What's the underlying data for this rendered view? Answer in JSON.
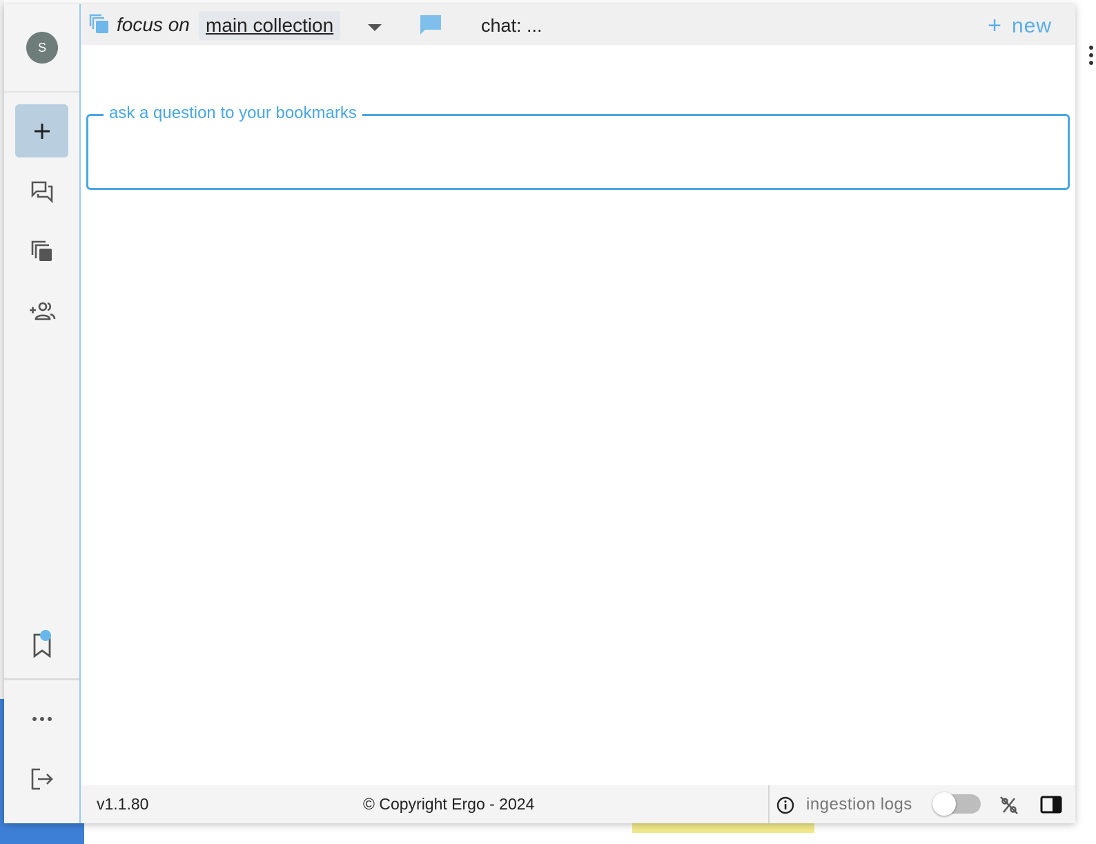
{
  "sidebar": {
    "avatar_initial": "S",
    "items": [
      {
        "name": "new-chat",
        "icon": "plus-icon"
      },
      {
        "name": "chats",
        "icon": "chat-list-icon"
      },
      {
        "name": "collections",
        "icon": "collections-icon"
      },
      {
        "name": "invite",
        "icon": "add-group-icon"
      }
    ],
    "bookmark_icon": "bookmark-icon",
    "more_icon": "more-horiz-icon",
    "logout_icon": "logout-icon"
  },
  "header": {
    "focus_label": "focus on",
    "collection": "main collection",
    "chat_title": "chat: ...",
    "new_label": "new",
    "new_plus": "+"
  },
  "question": {
    "legend": "ask a question to your bookmarks",
    "value": ""
  },
  "footer": {
    "version": "v1.1.80",
    "copyright": "© Copyright Ergo - 2024",
    "ingestion_label": "ingestion logs",
    "ingestion_enabled": false
  },
  "colors": {
    "accent": "#4aa6e2",
    "sidebar_active": "#b9cfdf",
    "badge": "#67b7ec"
  }
}
